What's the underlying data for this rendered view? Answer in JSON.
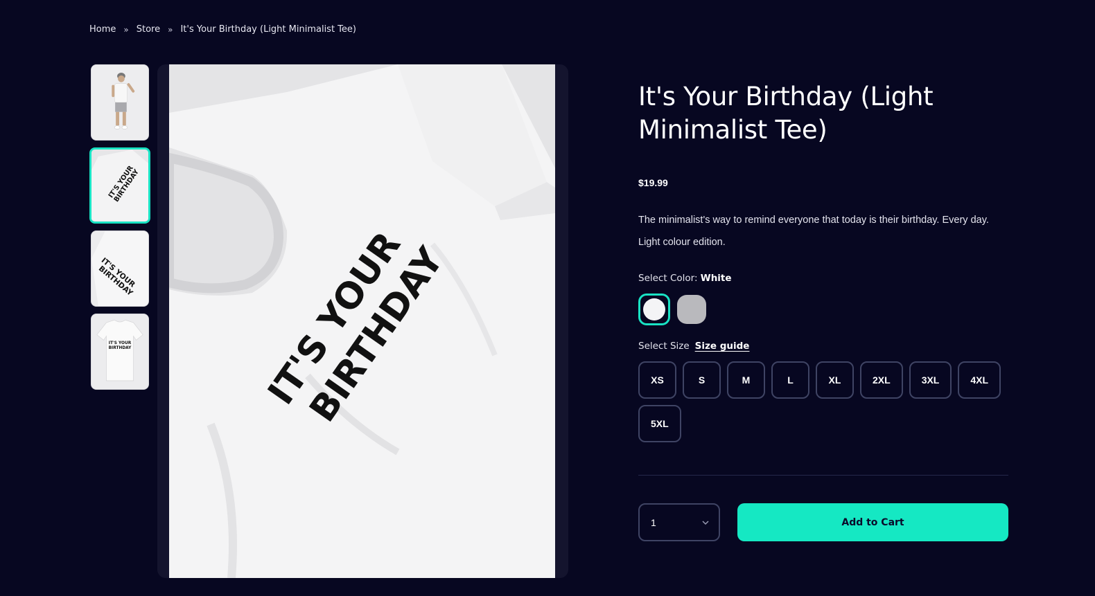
{
  "breadcrumb": {
    "items": [
      "Home",
      "Store",
      "It's Your Birthday (Light Minimalist Tee)"
    ],
    "separator": "»"
  },
  "product": {
    "title": "It's Your Birthday (Light Minimalist Tee)",
    "price": "$19.99",
    "description": "The minimalist's way to remind everyone that today is their birthday. Every day.",
    "description_2": "Light colour edition.",
    "shirt_print_line1": "IT'S YOUR",
    "shirt_print_line2": "BIRTHDAY"
  },
  "color": {
    "label": "Select Color:",
    "selected": "White",
    "swatches": [
      {
        "name": "White",
        "hex": "#f4f4f6"
      },
      {
        "name": "Grey",
        "hex": "#b9b9bd"
      }
    ]
  },
  "size": {
    "label": "Select Size",
    "guide_link": "Size guide",
    "options": [
      "XS",
      "S",
      "M",
      "L",
      "XL",
      "2XL",
      "3XL",
      "4XL",
      "5XL"
    ]
  },
  "cart": {
    "quantity": "1",
    "add_label": "Add to Cart"
  },
  "colors": {
    "background": "#070721",
    "accent": "#15e8c3",
    "border": "#3f4464"
  }
}
